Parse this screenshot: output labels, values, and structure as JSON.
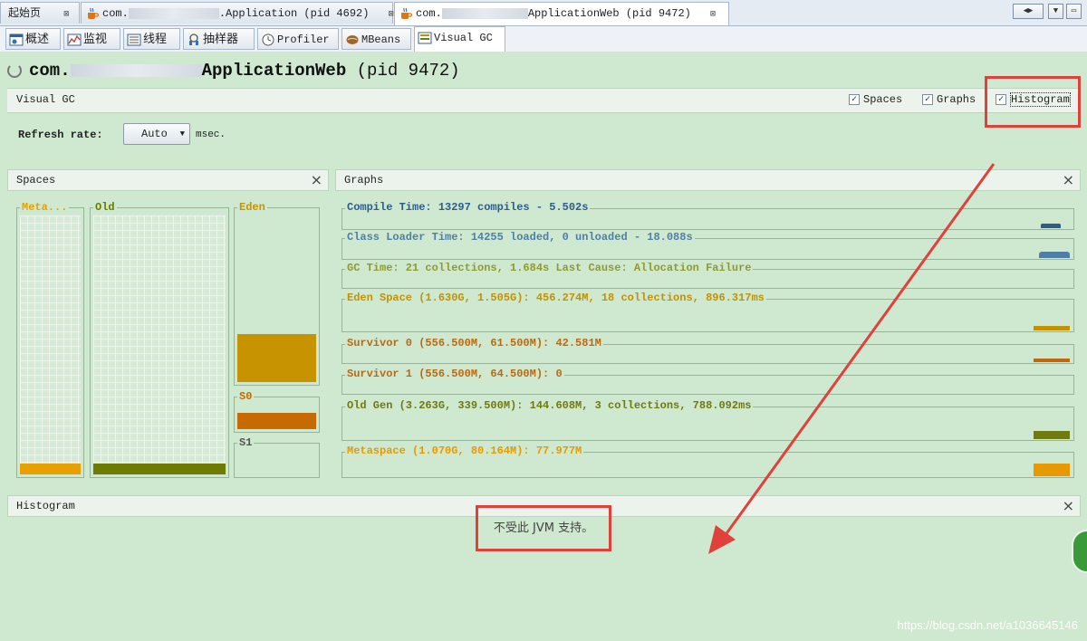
{
  "doc_tabs": [
    {
      "label": "起始页",
      "close": "⊠",
      "active": false
    },
    {
      "label_prefix": "com.",
      "label_suffix": ".Application (pid 4692)",
      "close": "⊠",
      "active": false
    },
    {
      "label_prefix": "com.",
      "label_suffix": "ApplicationWeb (pid 9472)",
      "close": "⊠",
      "active": true
    }
  ],
  "window_controls": {
    "prev": "◀",
    "next": "▶",
    "menu": "▼",
    "restore": "▭"
  },
  "sub_tabs": [
    "概述",
    "监视",
    "线程",
    "抽样器",
    "Profiler",
    "MBeans",
    "Visual GC"
  ],
  "title": {
    "prefix": "com.",
    "name": "ApplicationWeb",
    "pid": "(pid 9472)"
  },
  "visual_gc": {
    "label": "Visual GC",
    "checkboxes": [
      {
        "label": "Spaces",
        "checked": true
      },
      {
        "label": "Graphs",
        "checked": true
      },
      {
        "label": "Histogram",
        "checked": true
      }
    ],
    "check_glyph": "✓"
  },
  "refresh": {
    "label": "Refresh rate:",
    "value": "Auto",
    "unit": "msec."
  },
  "spaces_panel": {
    "title": "Spaces",
    "close": "×",
    "labels": {
      "meta": "Meta...",
      "old": "Old",
      "eden": "Eden",
      "s0": "S0",
      "s1": "S1"
    },
    "fill_fraction": {
      "meta": 0.04,
      "old": 0.04,
      "eden": 0.28,
      "s0": 0.55,
      "s1": 0.0
    }
  },
  "graphs_panel": {
    "title": "Graphs",
    "close": "×",
    "rows": [
      {
        "text": "Compile Time: 13297 compiles - 5.502s",
        "color": "#2d5d8a"
      },
      {
        "text": "Class Loader Time: 14255 loaded, 0 unloaded - 18.088s",
        "color": "#4f7fa6"
      },
      {
        "text": "GC Time: 21 collections, 1.684s  Last Cause: Allocation Failure",
        "color": "#8f9a2f"
      },
      {
        "text": "Eden Space (1.630G, 1.505G): 456.274M, 18 collections, 896.317ms",
        "color": "#c39200"
      },
      {
        "text": "Survivor 0 (556.500M, 61.500M): 42.581M",
        "color": "#c0670a"
      },
      {
        "text": "Survivor 1 (556.500M, 64.500M): 0",
        "color": "#c0670a"
      },
      {
        "text": "Old Gen (3.263G, 339.500M): 144.608M, 3 collections, 788.092ms",
        "color": "#6f7a10"
      },
      {
        "text": "Metaspace (1.070G, 80.164M): 77.977M",
        "color": "#e69a00"
      }
    ]
  },
  "histogram_panel": {
    "title": "Histogram",
    "close": "×",
    "message": "不受此 JVM 支持。"
  },
  "watermark": "https://blog.csdn.net/a1036645146",
  "colors": {
    "background": "#cfe8d0",
    "meta": "#e8a000",
    "old": "#6f7a00",
    "eden": "#c89300",
    "s0": "#c76a00",
    "highlight": "#e0413b"
  }
}
